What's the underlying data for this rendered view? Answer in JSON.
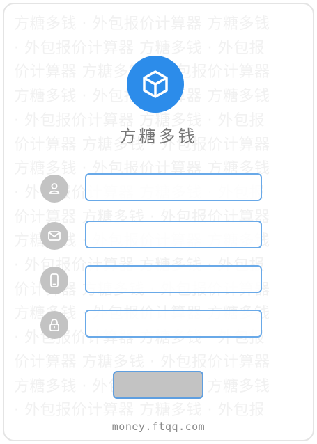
{
  "watermark": {
    "lines": [
      "方糖多钱 · 外包报价计算器 方糖多钱",
      "· 外包报价计算器 方糖多钱 · 外包报",
      "价计算器 方糖多钱 · 外包报价计算器",
      "方糖多钱 · 外包报价计算器 方糖多钱",
      "· 外包报价计算器 方糖多钱 · 外包报",
      "价计算器 方糖多钱 · 外包报价计算器",
      "方糖多钱 · 外包报价计算器 方糖多钱",
      "· 外包报价计算器 方糖多钱 · 外包报",
      "价计算器 方糖多钱 · 外包报价计算器",
      "方糖多钱 · 外包报价计算器 方糖多钱",
      "· 外包报价计算器 方糖多钱 · 外包报",
      "价计算器 方糖多钱 · 外包报价计算器",
      "方糖多钱 · 外包报价计算器 方糖多钱",
      "· 外包报价计算器 方糖多钱 · 外包报",
      "价计算器 方糖多钱 · 外包报价计算器",
      "方糖多钱 · 外包报价计算器 方糖多钱",
      "· 外包报价计算器 方糖多钱 · 外包报"
    ]
  },
  "brand": {
    "logo_icon": "cube-icon",
    "name": "方糖多钱",
    "color": "#2c8cea"
  },
  "form": {
    "fields": [
      {
        "icon": "user-icon",
        "value": "",
        "placeholder": ""
      },
      {
        "icon": "mail-icon",
        "value": "",
        "placeholder": ""
      },
      {
        "icon": "phone-icon",
        "value": "",
        "placeholder": ""
      },
      {
        "icon": "lock-icon",
        "value": "",
        "placeholder": ""
      }
    ],
    "submit_label": ""
  },
  "footer": {
    "url": "money.ftqq.com"
  }
}
